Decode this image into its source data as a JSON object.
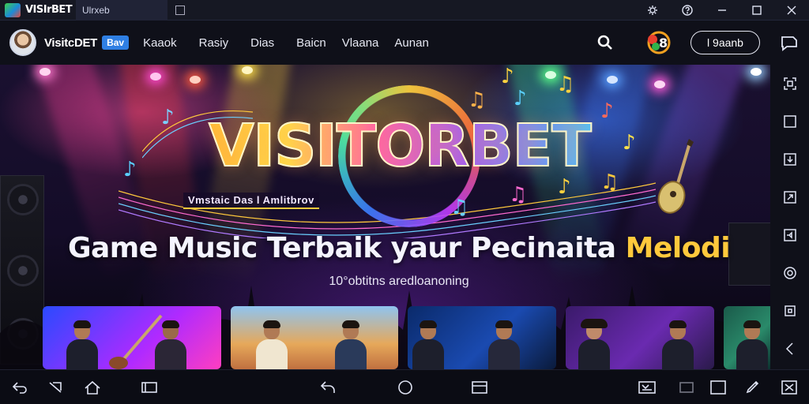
{
  "window": {
    "app_name": "VISIrBET",
    "tab_label": "Ulrxeb"
  },
  "navbar": {
    "brand": "VisitcDET",
    "brand_badge": "Bav",
    "items": [
      "Kaaok",
      "Rasiy",
      "Dias",
      "Baicn",
      "Vlaana",
      "Aunan"
    ],
    "pill_value": "l 9aanb"
  },
  "banner": {
    "logo_word": "VISITORBET",
    "logo_subtitle": "Vmstaic Das l Amlitbrov",
    "headline_main": "Game Music Terbaik yaur Pecinaita ",
    "headline_accent": "Melodi",
    "tagline": "10°obtitns aredloanoning"
  },
  "colors": {
    "accent_yellow": "#ffc93c",
    "brand_blue": "#2f7fe3",
    "background": "#0b0c14"
  },
  "icons": {
    "titlebar": [
      "gear-icon",
      "help-icon",
      "minimize-icon",
      "maximize-icon",
      "close-icon"
    ],
    "sidebar": [
      "screenshot-icon",
      "window-icon",
      "import-icon",
      "share-icon",
      "volume-icon",
      "settings-icon",
      "record-icon",
      "back-icon"
    ],
    "bottom": [
      "back-icon",
      "shake-icon",
      "home-icon",
      "recent-apps-icon",
      "rotate-icon",
      "circle-home-icon",
      "apps-icon",
      "keyboard-icon",
      "screen-icon",
      "fullscreen-toggle-icon",
      "edit-icon",
      "expand-icon"
    ]
  }
}
